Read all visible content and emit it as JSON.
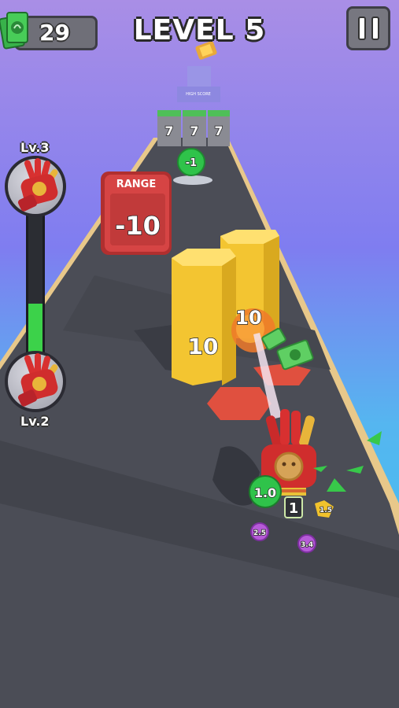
{
  "hud": {
    "cash_count": "29",
    "level_title": "LEVEL 5",
    "cash_icon": "cash-stack-icon",
    "pause_icon": "pause-icon"
  },
  "progress": {
    "next_level_label": "Lv.3",
    "current_level_label": "Lv.2",
    "fill_fraction": 0.35,
    "glove_icon": "glove-icon"
  },
  "track": {
    "range_gate_title": "RANGE",
    "range_gate_value": "-10",
    "green_orb_value": "-1",
    "distant_blocks": [
      "7",
      "7",
      "7"
    ],
    "finish_sign": "HIGH SCORE",
    "pillar_value": "10",
    "burst_value": "10"
  },
  "player": {
    "stat_orb": "1.0",
    "level_tag": "1",
    "small_orbs": [
      "2.5",
      "3.4",
      "1.5"
    ]
  },
  "colors": {
    "track": "#4a4c55",
    "rail": "#e9c98a",
    "pillar": "#f3c531",
    "gate": "#d23a3a",
    "green": "#2fc34a"
  }
}
